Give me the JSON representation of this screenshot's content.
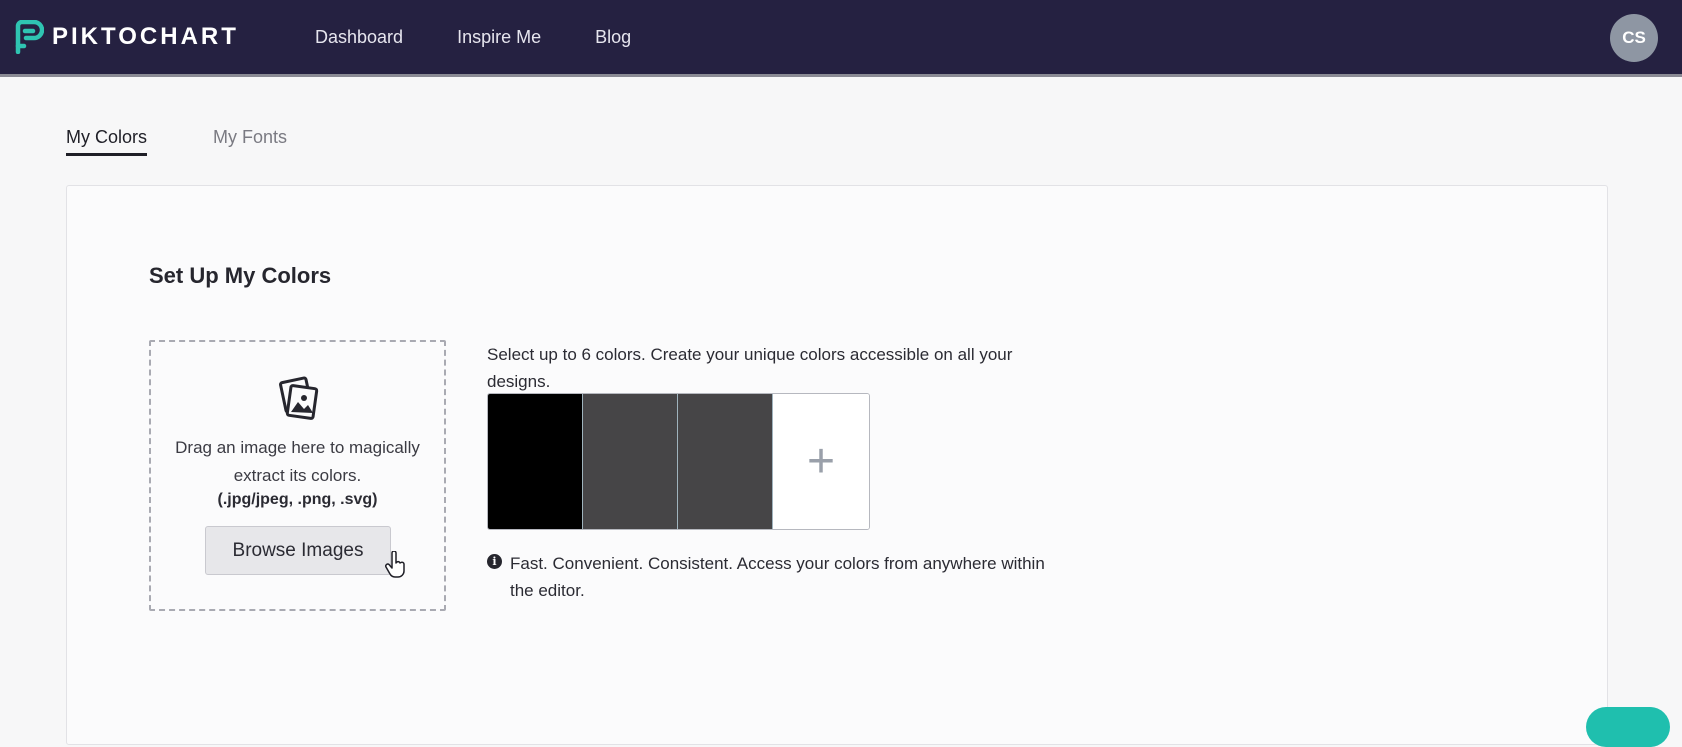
{
  "header": {
    "logo_text": "PIKTOCHART",
    "nav": [
      "Dashboard",
      "Inspire Me",
      "Blog"
    ],
    "avatar_initials": "CS",
    "bg_color": "#252141"
  },
  "tabs": [
    {
      "label": "My Colors",
      "active": true
    },
    {
      "label": "My Fonts",
      "active": false
    }
  ],
  "colors_panel": {
    "title": "Set Up My Colors",
    "dropzone": {
      "icon": "image-gallery-icon",
      "instruction": "Drag an image here to magically extract its colors.",
      "formats": "(.jpg/jpeg, .png, .svg)",
      "browse_label": "Browse Images"
    },
    "select_text": "Select up to 6 colors. Create your unique colors accessible on all your designs.",
    "swatches": [
      "#000000",
      "#464547",
      "#464547"
    ],
    "add_label": "+",
    "info_text": "Fast. Convenient. Consistent. Access your colors from anywhere within the editor."
  },
  "accent_color": "#1fbfae"
}
